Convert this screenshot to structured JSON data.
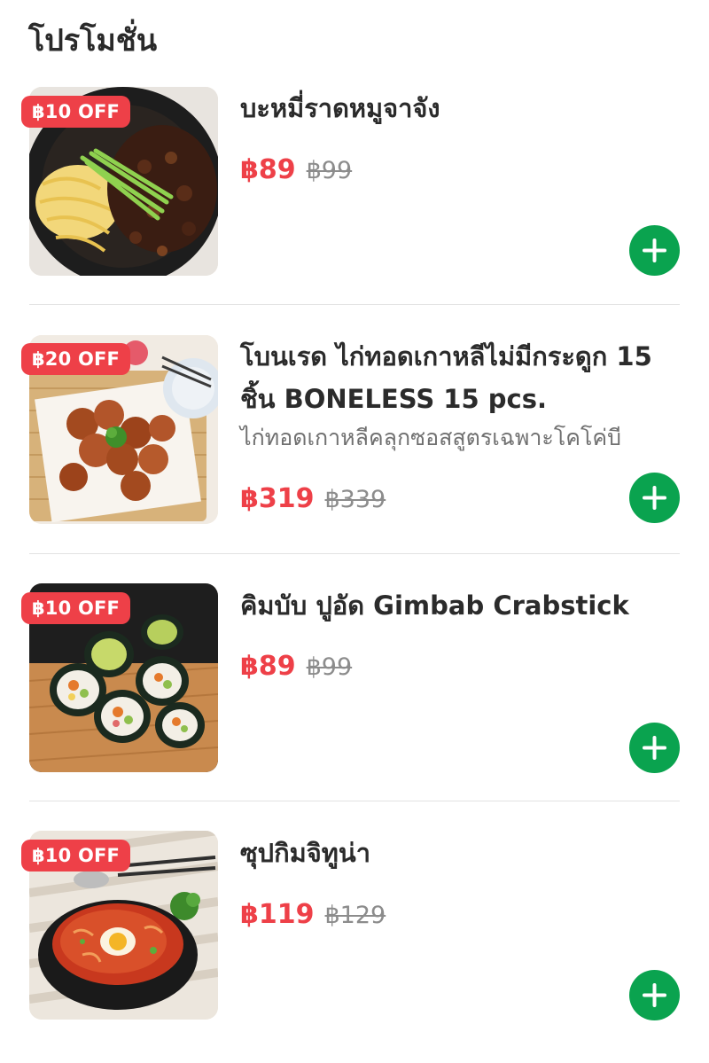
{
  "section": {
    "title": "โปรโมชั่น"
  },
  "items": [
    {
      "badge": "฿10 OFF",
      "name": "บะหมี่ราดหมูจาจัง",
      "description": "",
      "price": "฿89",
      "old_price": "฿99",
      "image": "jajangmyeon-noodles-image"
    },
    {
      "badge": "฿20 OFF",
      "name": "โบนเรด ไก่ทอดเกาหลีไม่มีกระดูก 15 ชิ้น BONELESS 15 pcs.",
      "description": "ไก่ทอดเกาหลีคลุกซอสสูตรเฉพาะโคโค่บี",
      "price": "฿319",
      "old_price": "฿339",
      "image": "korean-fried-chicken-image"
    },
    {
      "badge": "฿10 OFF",
      "name": "คิมบับ ปูอัด Gimbab Crabstick",
      "description": "",
      "price": "฿89",
      "old_price": "฿99",
      "image": "gimbap-rolls-image"
    },
    {
      "badge": "฿10 OFF",
      "name": "ซุปกิมจิทูน่า",
      "description": "",
      "price": "฿119",
      "old_price": "฿129",
      "image": "kimchi-tuna-soup-image"
    }
  ],
  "icons": {
    "add": "plus-icon"
  },
  "colors": {
    "discount": "#ee4048",
    "add_button": "#0aa34f",
    "text": "#2b2b2b",
    "muted": "#8c8c8c"
  }
}
